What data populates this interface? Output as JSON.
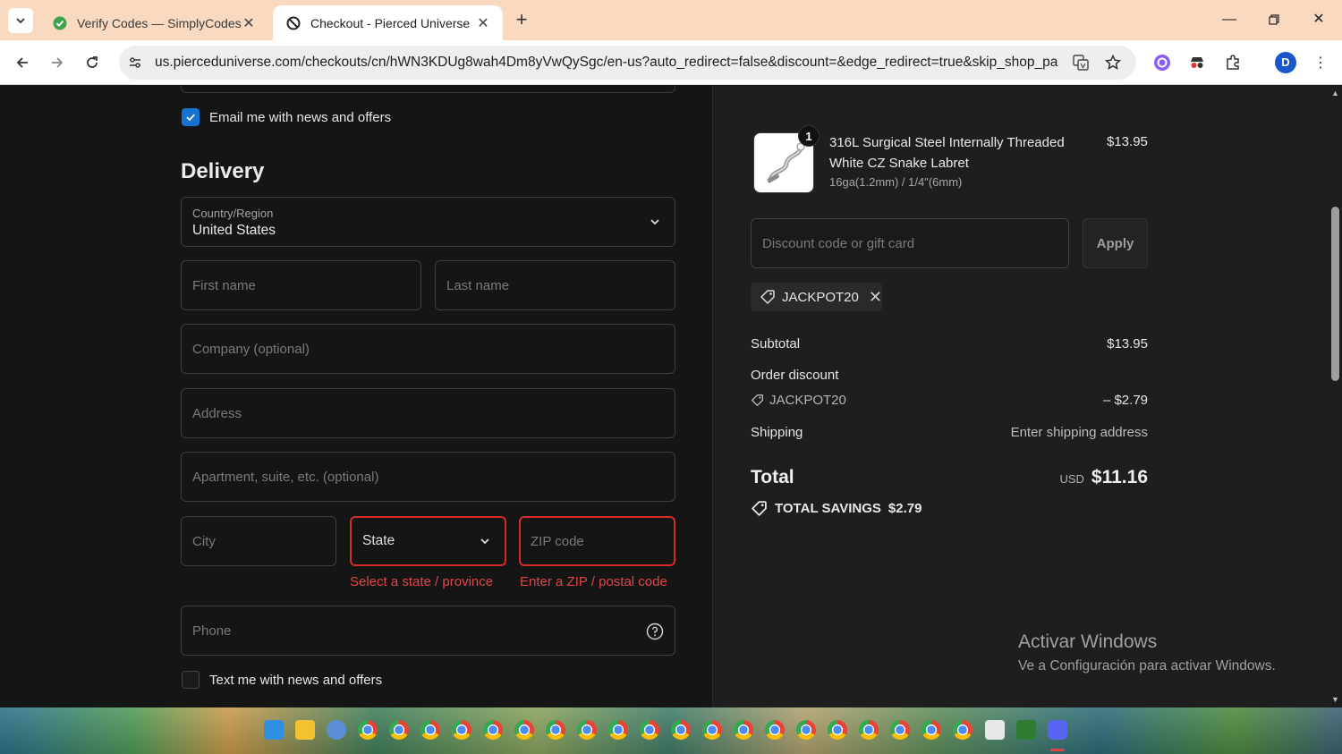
{
  "browser": {
    "tabs": [
      {
        "title": "Verify Codes — SimplyCodes",
        "active": false,
        "favicon": "simplycodes-icon"
      },
      {
        "title": "Checkout - Pierced Universe",
        "active": true,
        "favicon": "pierced-universe-icon"
      }
    ],
    "url": "us.pierceduniverse.com/checkouts/cn/hWN3KDUg8wah4Dm8yVwQySgc/en-us?auto_redirect=false&discount=&edge_redirect=true&skip_shop_pa...",
    "profile_initial": "D"
  },
  "checkout": {
    "email_optin_label": "Email me with news and offers",
    "email_optin_checked": true,
    "delivery_title": "Delivery",
    "country": {
      "label": "Country/Region",
      "value": "United States"
    },
    "fields": {
      "first_name": "First name",
      "last_name": "Last name",
      "company": "Company (optional)",
      "address": "Address",
      "apartment": "Apartment, suite, etc. (optional)",
      "city": "City",
      "state": "State",
      "zip": "ZIP code",
      "phone": "Phone"
    },
    "errors": {
      "state": "Select a state / province",
      "zip": "Enter a ZIP / postal code"
    },
    "sms_optin_label": "Text me with news and offers",
    "sms_optin_checked": false
  },
  "summary": {
    "product": {
      "quantity": "1",
      "name": "316L Surgical Steel Internally Threaded White CZ Snake Labret",
      "variant": "16ga(1.2mm) / 1/4\"(6mm)",
      "price": "$13.95"
    },
    "discount_placeholder": "Discount code or gift card",
    "apply_label": "Apply",
    "applied_code": "JACKPOT20",
    "subtotal_label": "Subtotal",
    "subtotal_value": "$13.95",
    "order_discount_label": "Order discount",
    "discount_code": "JACKPOT20",
    "discount_value": "– $2.79",
    "shipping_label": "Shipping",
    "shipping_value": "Enter shipping address",
    "total_label": "Total",
    "total_currency": "USD",
    "total_value": "$11.16",
    "savings_label": "TOTAL SAVINGS",
    "savings_value": "$2.79"
  },
  "watermark": {
    "title": "Activar Windows",
    "subtitle": "Ve a Configuración para activar Windows."
  },
  "colors": {
    "accent": "#1773d1",
    "error": "#d42b2b",
    "background": "#151515",
    "summary_background": "#1e1e1e"
  }
}
